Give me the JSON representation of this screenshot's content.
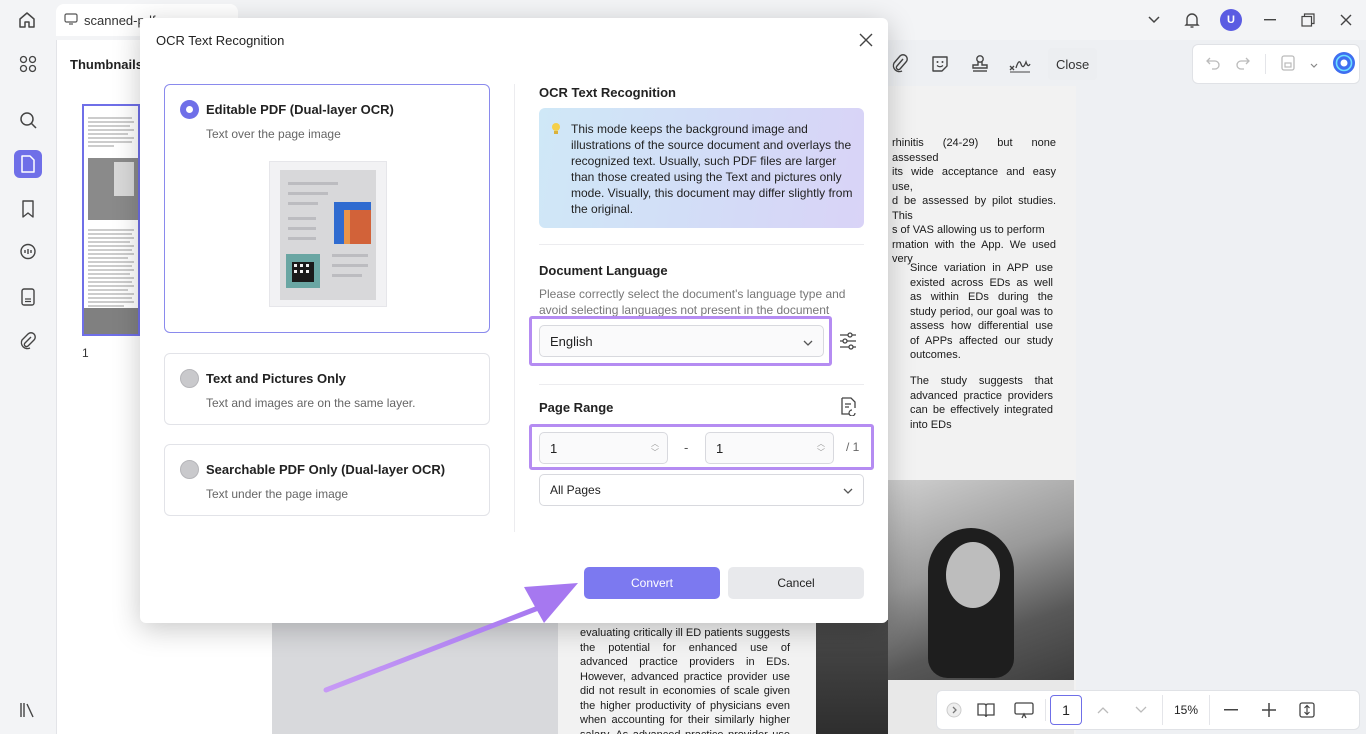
{
  "window": {
    "tab_title": "scanned-pdf",
    "user_initial": "U"
  },
  "thumbnails": {
    "title": "Thumbnails",
    "page_number": "1"
  },
  "toolbar": {
    "close_label": "Close"
  },
  "bottombar": {
    "page_value": "1",
    "zoom": "15%"
  },
  "document": {
    "lines_top": [
      "rhinitis (24-29) but none assessed",
      "its wide acceptance and easy use,",
      "d be assessed by pilot studies. This",
      "s of VAS allowing us to perform",
      "rmation with the App. We used very"
    ],
    "col2": "Since variation in APP use existed across EDs as well as within EDs during the study period, our goal was to assess how differential use of APPs affected our study outcomes.",
    "col2b": "The study suggests that advanced practice providers can be effectively integrated into EDs",
    "col1_bottom": "evaluating critically ill ED patients suggests the potential for enhanced use of advanced practice providers in EDs. However, advanced practice provider use did not result in economies of scale given the higher productivity of physicians even when accounting for their similarly higher salary. As advanced practice provider use in"
  },
  "modal": {
    "title": "OCR Text Recognition",
    "options": [
      {
        "title": "Editable PDF (Dual-layer OCR)",
        "subtitle": "Text over the page image",
        "selected": true
      },
      {
        "title": "Text and Pictures Only",
        "subtitle": "Text and images are on the same layer.",
        "selected": false
      },
      {
        "title": "Searchable PDF Only (Dual-layer OCR)",
        "subtitle": "Text under the page image",
        "selected": false
      }
    ],
    "right_title": "OCR Text Recognition",
    "info_text": "This mode keeps the background image and illustrations of the source document and overlays the recognized text. Usually, such PDF files are larger than those created using the Text and pictures only mode. Visually, this document may differ slightly from the original.",
    "doc_language_title": "Document Language",
    "doc_language_hint": "Please correctly select the document's language type and avoid selecting languages not present in the document",
    "language_value": "English",
    "page_range_title": "Page Range",
    "range_from": "1",
    "range_to": "1",
    "range_dash": "-",
    "range_total": "/ 1",
    "pages_select": "All Pages",
    "convert_label": "Convert",
    "cancel_label": "Cancel"
  },
  "colors": {
    "accent": "#6f6fe8",
    "highlight": "#b58cf2"
  }
}
